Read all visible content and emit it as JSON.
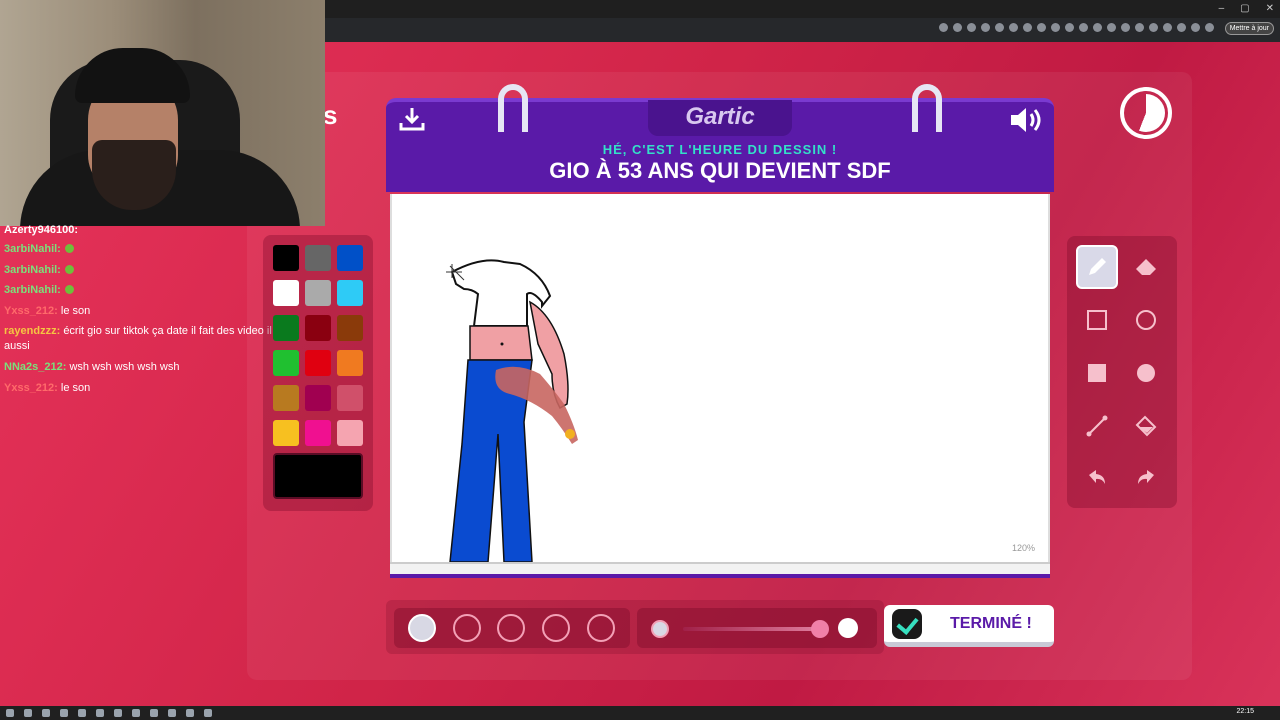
{
  "window": {
    "update_label": "Mettre à jour",
    "controls": [
      "–",
      "▢",
      "✕"
    ]
  },
  "game": {
    "brand": "Gartic",
    "subtitle": "HÉ, C'EST L'HEURE DU DESSIN !",
    "theme": "GIO À 53 ANS QUI DEVIENT SDF",
    "zoom": "120%",
    "done_label": "TERMINÉ !",
    "time_remaining_fraction": 0.56
  },
  "palette": {
    "colors": [
      "#000000",
      "#666666",
      "#0050c8",
      "#ffffff",
      "#aaaaaa",
      "#2ecbf6",
      "#0a7a1e",
      "#8a0010",
      "#8a3a0a",
      "#20c030",
      "#e00010",
      "#f07a20",
      "#b87a20",
      "#a00050",
      "#d0506a",
      "#f7c020",
      "#f01090",
      "#f5a4b0"
    ],
    "selected": "#000000"
  },
  "tools": [
    {
      "name": "pencil-icon",
      "active": true
    },
    {
      "name": "eraser-icon",
      "active": false
    },
    {
      "name": "rect-outline-icon",
      "active": false
    },
    {
      "name": "circle-outline-icon",
      "active": false
    },
    {
      "name": "rect-fill-icon",
      "active": false
    },
    {
      "name": "circle-fill-icon",
      "active": false
    },
    {
      "name": "line-icon",
      "active": false
    },
    {
      "name": "fill-bucket-icon",
      "active": false
    },
    {
      "name": "undo-icon",
      "active": false
    },
    {
      "name": "redo-icon",
      "active": false
    }
  ],
  "chat": [
    {
      "user": "Azerty946100:",
      "text": "",
      "color": "#ffffff"
    },
    {
      "user": "3arbiNahil:",
      "text": "",
      "color": "#7be07b"
    },
    {
      "user": "3arbiNahil:",
      "text": "",
      "color": "#7be07b"
    },
    {
      "user": "3arbiNahil:",
      "text": "",
      "color": "#7be07b"
    },
    {
      "user": "Yxss_212:",
      "text": "le son",
      "color": "#ff6a6a"
    },
    {
      "user": "rayendzzz:",
      "text": "écrit gio sur tiktok ça date il fait des video il live",
      "text2": "aussi",
      "color": "#f5c542"
    },
    {
      "user": "NNa2s_212:",
      "text": "wsh wsh wsh wsh wsh",
      "color": "#7be07b"
    },
    {
      "user": "Yxss_212:",
      "text": "le son",
      "color": "#ff6a6a"
    }
  ],
  "clock": "22:15"
}
